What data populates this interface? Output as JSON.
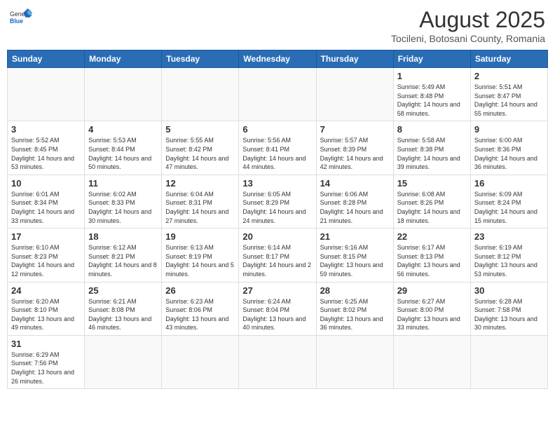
{
  "header": {
    "logo_general": "General",
    "logo_blue": "Blue",
    "month_year": "August 2025",
    "location": "Tocileni, Botosani County, Romania"
  },
  "days_of_week": [
    "Sunday",
    "Monday",
    "Tuesday",
    "Wednesday",
    "Thursday",
    "Friday",
    "Saturday"
  ],
  "weeks": [
    [
      {
        "day": null,
        "info": null
      },
      {
        "day": null,
        "info": null
      },
      {
        "day": null,
        "info": null
      },
      {
        "day": null,
        "info": null
      },
      {
        "day": null,
        "info": null
      },
      {
        "day": "1",
        "info": "Sunrise: 5:49 AM\nSunset: 8:48 PM\nDaylight: 14 hours and 58 minutes."
      },
      {
        "day": "2",
        "info": "Sunrise: 5:51 AM\nSunset: 8:47 PM\nDaylight: 14 hours and 55 minutes."
      }
    ],
    [
      {
        "day": "3",
        "info": "Sunrise: 5:52 AM\nSunset: 8:45 PM\nDaylight: 14 hours and 53 minutes."
      },
      {
        "day": "4",
        "info": "Sunrise: 5:53 AM\nSunset: 8:44 PM\nDaylight: 14 hours and 50 minutes."
      },
      {
        "day": "5",
        "info": "Sunrise: 5:55 AM\nSunset: 8:42 PM\nDaylight: 14 hours and 47 minutes."
      },
      {
        "day": "6",
        "info": "Sunrise: 5:56 AM\nSunset: 8:41 PM\nDaylight: 14 hours and 44 minutes."
      },
      {
        "day": "7",
        "info": "Sunrise: 5:57 AM\nSunset: 8:39 PM\nDaylight: 14 hours and 42 minutes."
      },
      {
        "day": "8",
        "info": "Sunrise: 5:58 AM\nSunset: 8:38 PM\nDaylight: 14 hours and 39 minutes."
      },
      {
        "day": "9",
        "info": "Sunrise: 6:00 AM\nSunset: 8:36 PM\nDaylight: 14 hours and 36 minutes."
      }
    ],
    [
      {
        "day": "10",
        "info": "Sunrise: 6:01 AM\nSunset: 8:34 PM\nDaylight: 14 hours and 33 minutes."
      },
      {
        "day": "11",
        "info": "Sunrise: 6:02 AM\nSunset: 8:33 PM\nDaylight: 14 hours and 30 minutes."
      },
      {
        "day": "12",
        "info": "Sunrise: 6:04 AM\nSunset: 8:31 PM\nDaylight: 14 hours and 27 minutes."
      },
      {
        "day": "13",
        "info": "Sunrise: 6:05 AM\nSunset: 8:29 PM\nDaylight: 14 hours and 24 minutes."
      },
      {
        "day": "14",
        "info": "Sunrise: 6:06 AM\nSunset: 8:28 PM\nDaylight: 14 hours and 21 minutes."
      },
      {
        "day": "15",
        "info": "Sunrise: 6:08 AM\nSunset: 8:26 PM\nDaylight: 14 hours and 18 minutes."
      },
      {
        "day": "16",
        "info": "Sunrise: 6:09 AM\nSunset: 8:24 PM\nDaylight: 14 hours and 15 minutes."
      }
    ],
    [
      {
        "day": "17",
        "info": "Sunrise: 6:10 AM\nSunset: 8:23 PM\nDaylight: 14 hours and 12 minutes."
      },
      {
        "day": "18",
        "info": "Sunrise: 6:12 AM\nSunset: 8:21 PM\nDaylight: 14 hours and 8 minutes."
      },
      {
        "day": "19",
        "info": "Sunrise: 6:13 AM\nSunset: 8:19 PM\nDaylight: 14 hours and 5 minutes."
      },
      {
        "day": "20",
        "info": "Sunrise: 6:14 AM\nSunset: 8:17 PM\nDaylight: 14 hours and 2 minutes."
      },
      {
        "day": "21",
        "info": "Sunrise: 6:16 AM\nSunset: 8:15 PM\nDaylight: 13 hours and 59 minutes."
      },
      {
        "day": "22",
        "info": "Sunrise: 6:17 AM\nSunset: 8:13 PM\nDaylight: 13 hours and 56 minutes."
      },
      {
        "day": "23",
        "info": "Sunrise: 6:19 AM\nSunset: 8:12 PM\nDaylight: 13 hours and 53 minutes."
      }
    ],
    [
      {
        "day": "24",
        "info": "Sunrise: 6:20 AM\nSunset: 8:10 PM\nDaylight: 13 hours and 49 minutes."
      },
      {
        "day": "25",
        "info": "Sunrise: 6:21 AM\nSunset: 8:08 PM\nDaylight: 13 hours and 46 minutes."
      },
      {
        "day": "26",
        "info": "Sunrise: 6:23 AM\nSunset: 8:06 PM\nDaylight: 13 hours and 43 minutes."
      },
      {
        "day": "27",
        "info": "Sunrise: 6:24 AM\nSunset: 8:04 PM\nDaylight: 13 hours and 40 minutes."
      },
      {
        "day": "28",
        "info": "Sunrise: 6:25 AM\nSunset: 8:02 PM\nDaylight: 13 hours and 36 minutes."
      },
      {
        "day": "29",
        "info": "Sunrise: 6:27 AM\nSunset: 8:00 PM\nDaylight: 13 hours and 33 minutes."
      },
      {
        "day": "30",
        "info": "Sunrise: 6:28 AM\nSunset: 7:58 PM\nDaylight: 13 hours and 30 minutes."
      }
    ],
    [
      {
        "day": "31",
        "info": "Sunrise: 6:29 AM\nSunset: 7:56 PM\nDaylight: 13 hours and 26 minutes."
      },
      {
        "day": null,
        "info": null
      },
      {
        "day": null,
        "info": null
      },
      {
        "day": null,
        "info": null
      },
      {
        "day": null,
        "info": null
      },
      {
        "day": null,
        "info": null
      },
      {
        "day": null,
        "info": null
      }
    ]
  ]
}
